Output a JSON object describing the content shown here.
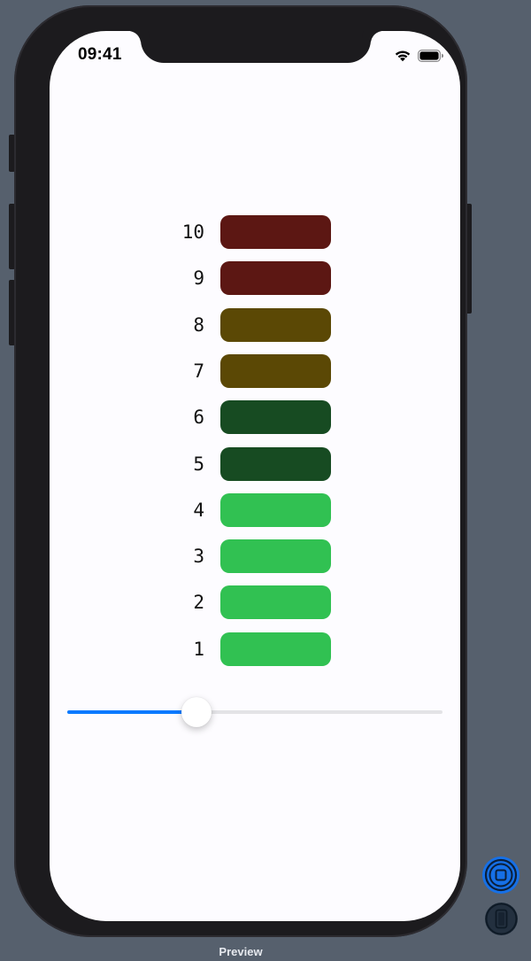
{
  "status_bar": {
    "time": "09:41",
    "wifi_icon": "wifi-icon",
    "battery_icon": "battery-icon"
  },
  "level_meter": {
    "rows": [
      {
        "label": "10",
        "color": "#5c1713"
      },
      {
        "label": "9",
        "color": "#5c1713"
      },
      {
        "label": "8",
        "color": "#5b4805"
      },
      {
        "label": "7",
        "color": "#5b4805"
      },
      {
        "label": "6",
        "color": "#174b22"
      },
      {
        "label": "5",
        "color": "#174b22"
      },
      {
        "label": "4",
        "color": "#31c152"
      },
      {
        "label": "3",
        "color": "#31c152"
      },
      {
        "label": "2",
        "color": "#31c152"
      },
      {
        "label": "1",
        "color": "#31c152"
      }
    ]
  },
  "slider": {
    "value_fraction": 0.345,
    "accent_color": "#0a7aff"
  },
  "preview_controls": {
    "label": "Preview",
    "live_button_icon": "live-preview-icon",
    "device_button_icon": "device-icon"
  }
}
